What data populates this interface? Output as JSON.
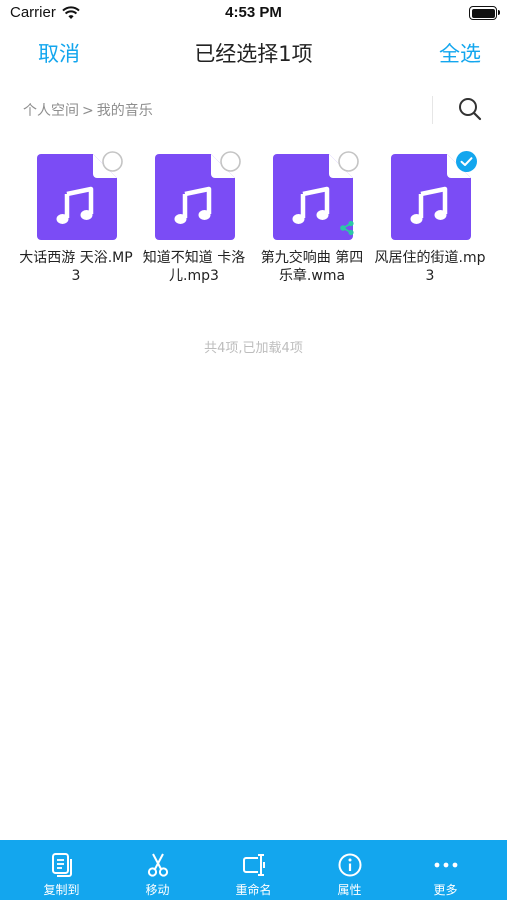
{
  "status_bar": {
    "carrier": "Carrier",
    "time": "4:53 PM",
    "battery_level": 1.0
  },
  "nav": {
    "cancel_label": "取消",
    "title": "已经选择1项",
    "select_all_label": "全选"
  },
  "breadcrumb": {
    "items": [
      "个人空间",
      "我的音乐"
    ],
    "separator": ">"
  },
  "files": [
    {
      "name": "大话西游 天浴.MP3",
      "selected": false,
      "shared": false
    },
    {
      "name": "知道不知道 卡洛儿.mp3",
      "selected": false,
      "shared": false
    },
    {
      "name": "第九交响曲 第四乐章.wma",
      "selected": false,
      "shared": true
    },
    {
      "name": "风居住的街道.mp3",
      "selected": true,
      "shared": false
    }
  ],
  "summary": "共4项,已加载4项",
  "toolbar": {
    "copy_label": "复制到",
    "move_label": "移动",
    "rename_label": "重命名",
    "properties_label": "属性",
    "more_label": "更多"
  },
  "colors": {
    "accent": "#13a6ee",
    "file_icon": "#7b4cf5",
    "share": "#2bc8a4"
  },
  "icons": [
    "wifi-icon",
    "battery-icon",
    "search-icon",
    "music-file-icon",
    "check-circle-icon",
    "share-icon",
    "copy-icon",
    "scissors-icon",
    "rename-icon",
    "info-icon",
    "more-icon"
  ]
}
